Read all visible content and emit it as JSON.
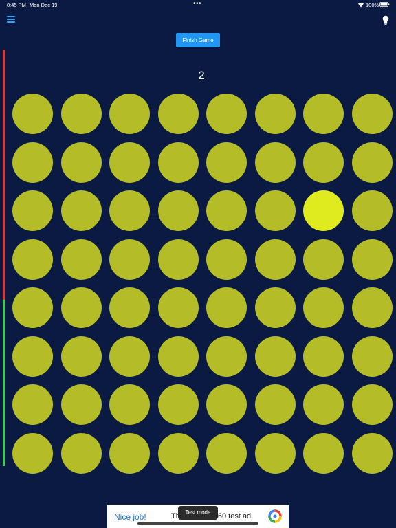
{
  "status_bar": {
    "time": "8:45 PM",
    "date": "Mon Dec 19",
    "dots": "•••",
    "battery": "100%",
    "wifi_icon": "wifi-icon",
    "battery_icon": "battery-icon"
  },
  "toolbar": {
    "menu_icon": "hamburger-menu-icon",
    "hint_icon": "lightbulb-icon",
    "finish_label": "Finish Game"
  },
  "game": {
    "score": "2",
    "timer_remaining_fraction": 0.4,
    "rows": 8,
    "cols": 8,
    "highlighted_cell": {
      "row": 3,
      "col": 7
    },
    "colors": {
      "background": "#0b1a42",
      "dot": "#b4bc27",
      "dot_highlight": "#dfea1f",
      "timer_elapsed": "#d03a3a",
      "timer_remaining": "#3fc46a",
      "accent": "#2196f3"
    }
  },
  "ad": {
    "title": "Nice job!",
    "text": "This is a 468x60 test ad.",
    "badge": "Test mode",
    "logo_icon": "google-ads-logo-icon"
  }
}
